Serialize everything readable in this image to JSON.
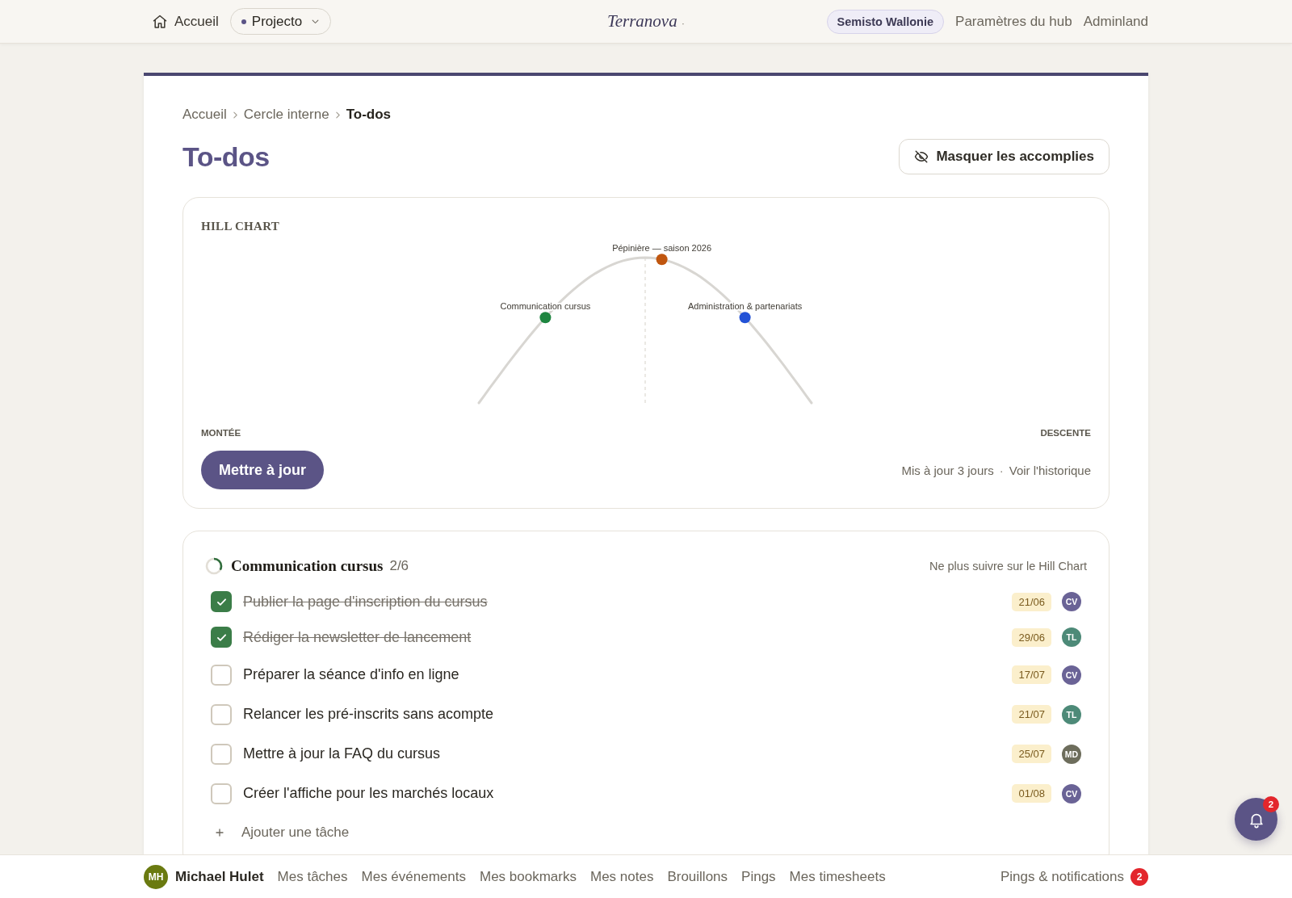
{
  "top_bar": {
    "home": "Accueil",
    "project_switcher": "Projecto",
    "logo": {
      "text": "Terranova",
      "mark": "·"
    },
    "hub": "Semisto Wallonie",
    "links": [
      "Paramètres du hub",
      "Adminland"
    ]
  },
  "breadcrumb": [
    {
      "label": "Accueil",
      "current": false
    },
    {
      "label": "Cercle interne",
      "current": false
    },
    {
      "label": "To-dos",
      "current": true
    }
  ],
  "page_title": "To-dos",
  "hide_completed_button": "Masquer les accomplies",
  "hill_chart": {
    "title": "HILL CHART",
    "points": [
      {
        "label": "Communication cursus",
        "color": "#1e8540",
        "level": 0.2
      },
      {
        "label": "Pépinière — saison 2026",
        "color": "#c0560f",
        "level": 0.55
      },
      {
        "label": "Administration & partenariats",
        "color": "#2352d6",
        "level": 0.8
      }
    ],
    "left_label": "MONTÉE",
    "right_label": "DESCENTE",
    "update_button": "Mettre à jour",
    "updated": "Mis à jour 3 jours",
    "separator": "·",
    "history_link": "Voir l'historique"
  },
  "todo_list": {
    "title": "Communication cursus",
    "count": "2/6",
    "unfollow_link": "Ne plus suivre sur le Hill Chart",
    "items": [
      {
        "text": "Publier la page d'inscription du cursus",
        "checked": true,
        "due": "21/06",
        "assignee": {
          "initials": "CV",
          "color": "#6a6396"
        }
      },
      {
        "text": "Rédiger la newsletter de lancement",
        "checked": true,
        "due": "29/06",
        "assignee": {
          "initials": "TL",
          "color": "#4d8a78"
        }
      },
      {
        "text": "Préparer la séance d'info en ligne",
        "checked": false,
        "due": "17/07",
        "assignee": {
          "initials": "CV",
          "color": "#6a6396"
        }
      },
      {
        "text": "Relancer les pré-inscrits sans acompte",
        "checked": false,
        "due": "21/07",
        "assignee": {
          "initials": "TL",
          "color": "#4d8a78"
        }
      },
      {
        "text": "Mettre à jour la FAQ du cursus",
        "checked": false,
        "due": "25/07",
        "assignee": {
          "initials": "MD",
          "color": "#6d6d5c"
        }
      },
      {
        "text": "Créer l'affiche pour les marchés locaux",
        "checked": false,
        "due": "01/08",
        "assignee": {
          "initials": "CV",
          "color": "#6a6396"
        }
      }
    ],
    "add_task": "Ajouter une tâche"
  },
  "bottom_bar": {
    "user": {
      "initials": "MH",
      "name": "Michael Hulet"
    },
    "links": [
      "Mes tâches",
      "Mes événements",
      "Mes bookmarks",
      "Mes notes",
      "Brouillons",
      "Pings",
      "Mes timesheets"
    ],
    "notifications": {
      "label": "Pings & notifications",
      "count": "2"
    }
  },
  "floating_bell": {
    "count": "2"
  }
}
